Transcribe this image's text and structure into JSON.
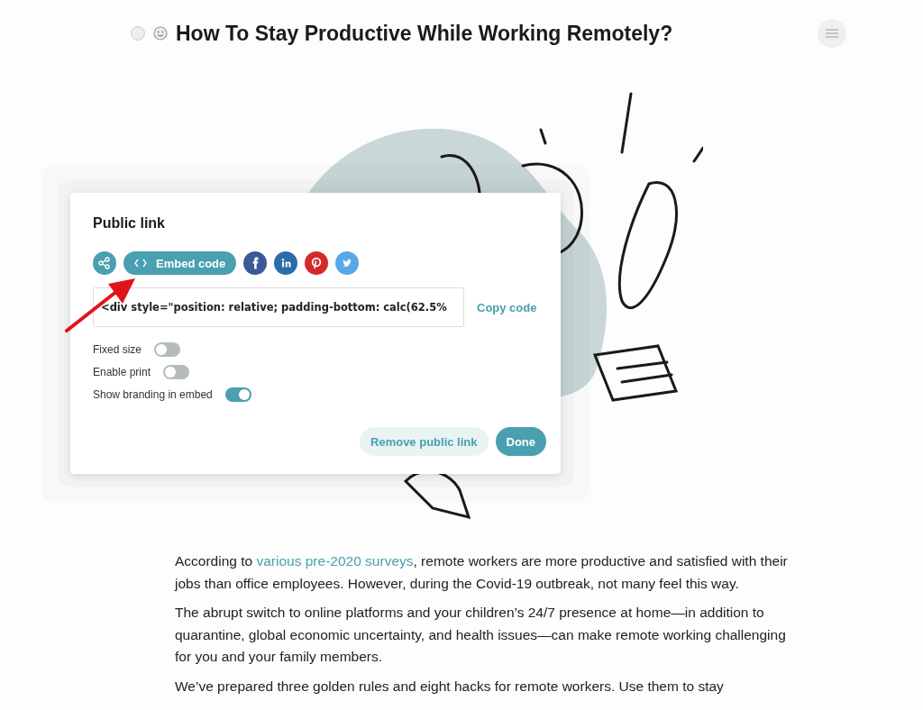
{
  "header": {
    "title": "How To Stay Productive While Working Remotely?"
  },
  "dialog": {
    "title": "Public link",
    "share_options": [
      {
        "kind": "share",
        "selected": false
      },
      {
        "kind": "embed",
        "label": "Embed code",
        "selected": true
      },
      {
        "kind": "facebook",
        "selected": false
      },
      {
        "kind": "linkedin",
        "selected": false
      },
      {
        "kind": "pinterest",
        "selected": false
      },
      {
        "kind": "twitter",
        "selected": false
      }
    ],
    "code_field": {
      "value": "<div style=\"position: relative; padding-bottom: calc(62.5%"
    },
    "copy_label": "Copy code",
    "toggles": [
      {
        "label": "Fixed size",
        "on": false
      },
      {
        "label": "Enable print",
        "on": false
      },
      {
        "label": "Show branding in embed",
        "on": true
      }
    ],
    "buttons": [
      {
        "label": "Remove public link",
        "kind": "secondary"
      },
      {
        "label": "Done",
        "kind": "primary"
      }
    ]
  },
  "article": {
    "paragraphs": [
      {
        "segments": [
          {
            "kind": "text",
            "text": "According to "
          },
          {
            "kind": "link",
            "text": "various pre-2020 surveys"
          },
          {
            "kind": "text",
            "text": ", remote workers are more productive and satisfied with their jobs than office employees. However, during the Covid-19 outbreak, not many feel this way."
          }
        ]
      },
      {
        "segments": [
          {
            "kind": "text",
            "text": "The abrupt switch to online platforms and your children’s 24/7 presence at home—in addition to quarantine, global economic uncertainty, and health issues—can make remote working challenging for you and your family members."
          }
        ]
      },
      {
        "segments": [
          {
            "kind": "text",
            "text": "We’ve prepared three golden rules and eight hacks for remote workers. Use them to stay"
          }
        ]
      }
    ]
  }
}
